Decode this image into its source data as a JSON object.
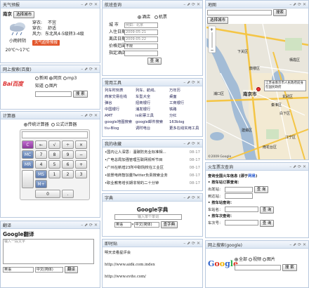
{
  "weather": {
    "title": "天气预报",
    "city": "南京",
    "city_btn": "选择城市",
    "condition": "小雨转阴",
    "temp": "20℃～17℃",
    "rows": [
      {
        "k": "穿衣:",
        "v": "不宜"
      },
      {
        "k": "穿衣:",
        "v": "舒适"
      },
      {
        "k": "风力:",
        "v": "东北风4-5级转3-4级"
      }
    ],
    "link": "天气趋势预报"
  },
  "baidu": {
    "title": "网上搜索(百度)",
    "logo": "Bai百度",
    "opts": [
      "新闻",
      "网页",
      "mp3",
      "知道",
      "图片"
    ],
    "btn": "搜 索"
  },
  "calc": {
    "title": "计算器",
    "modes": [
      "传统计算器",
      "公式计算器"
    ],
    "keys": [
      [
        "C",
        "←",
        "√",
        "÷",
        "×"
      ],
      [
        "MC",
        "7",
        "8",
        "9",
        "−"
      ],
      [
        "MR",
        "4",
        "5",
        "6",
        "+"
      ],
      [
        "MS",
        "1",
        "2",
        "3",
        ""
      ],
      [
        "M+",
        "0",
        "",
        "."
      ]
    ]
  },
  "translate": {
    "title": "翻译",
    "heading": "Google翻译",
    "placeholder": "输入一段文字",
    "from": "英语",
    "to": "中文(简体)",
    "btn": "翻译"
  },
  "flight": {
    "title": "航班查询",
    "modes": [
      "酒店",
      "机票"
    ],
    "fields": [
      {
        "k": "城 市",
        "v": "例如：北京"
      },
      {
        "k": "入住日期",
        "v": "2009-05-21"
      },
      {
        "k": "离店日期",
        "v": "2009-05-22"
      },
      {
        "k": "价格范围",
        "v": "不限"
      },
      {
        "k": "指定酒店",
        "v": ""
      }
    ],
    "btn": "查 询"
  },
  "tools": {
    "title": "常用工具",
    "items": [
      "列车时刻表",
      "列车、航线、",
      "万年历",
      "商家交易在线",
      "车型大全",
      "桌面",
      "弹谷",
      "招商银行",
      "工商银行",
      "中国银行",
      "浦发银行",
      "铁路",
      "AMT",
      "ie彩票工具",
      "分红",
      "google地图搜索",
      "google邮件搜索",
      "163blog",
      "tiu-Blog",
      "调时电台",
      "更多在线实用工具"
    ]
  },
  "favorites": {
    "title": "我的收藏",
    "items": [
      {
        "t": "国内让人深思：温碳防务业标准相...",
        "d": "08-17"
      },
      {
        "t": "广电总局加强管理互联网视听节目",
        "d": "08-17"
      },
      {
        "t": "广州在新增23所中职院校在工业区",
        "d": "08-17"
      },
      {
        "t": "前景电商智加量Twitter负责搜索业务",
        "d": "08-17"
      },
      {
        "t": "职业教育增长期非常的二十分钟",
        "d": "08-17"
      }
    ]
  },
  "dict": {
    "title": "字典",
    "heading": "Google字典",
    "placeholder": "输入单个单词",
    "from": "英语",
    "to": "中文(简体)",
    "btn": "查字典"
  },
  "notes": {
    "title": "即时贴",
    "lines": [
      "明天去看星评会",
      "http://www.aidk.com.index",
      "http://www.evite.com/"
    ]
  },
  "map": {
    "title": "地图",
    "search_btn": "搜索",
    "city_btn": "选择城市",
    "label": "南京市",
    "callout": "江苏省南京市人民政府前身在国民政府",
    "places": [
      "鼓楼区",
      "玄武区",
      "白下区",
      "雨花台区",
      "南京市",
      "秦淮区",
      "建邺区",
      "下关区",
      "栖霞区",
      "江宁区",
      "浦口区"
    ],
    "credit": "©2009 Google"
  },
  "train": {
    "title": "火车票次查询",
    "heading": "查询全国火车信息 (源于",
    "link": "网易",
    "tail": ")",
    "sections": [
      "• 按车站订票查询：",
      "• 按车站查询：",
      "• 按车次查询："
    ],
    "fields": [
      "出发站：",
      "到达站：",
      "车站名：",
      "车次号："
    ],
    "btn": "查 询"
  },
  "gsearch": {
    "title": "网上搜索(google)",
    "opts": [
      "全部",
      "视频",
      "图片"
    ],
    "btn": "搜 索"
  }
}
